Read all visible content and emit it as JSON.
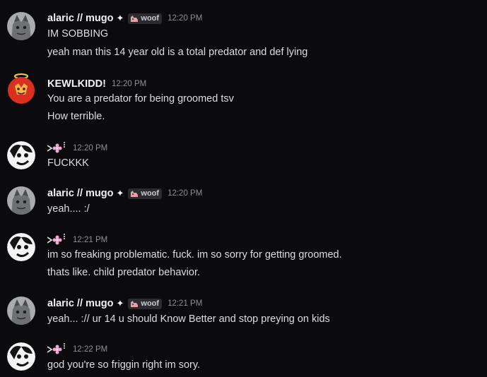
{
  "messages": [
    {
      "author": "alaric // mugo",
      "sparkle": "✦",
      "tag": "woof",
      "time": "12:20 PM",
      "lines": [
        "IM SOBBING",
        "yeah man this 14 year old is a total predator and def lying"
      ]
    },
    {
      "author": "KEWLKIDD!",
      "time": "12:20 PM",
      "lines": [
        "You are a predator for being groomed tsv",
        "How terrible."
      ]
    },
    {
      "time": "12:20 PM",
      "lines": [
        "FUCKKK"
      ]
    },
    {
      "author": "alaric // mugo",
      "sparkle": "✦",
      "tag": "woof",
      "time": "12:20 PM",
      "lines": [
        "yeah.... :/"
      ]
    },
    {
      "time": "12:21 PM",
      "lines": [
        "im so freaking problematic. fuck. im so sorry for getting groomed.",
        "thats like. child predator behavior."
      ]
    },
    {
      "author": "alaric // mugo",
      "sparkle": "✦",
      "tag": "woof",
      "time": "12:21 PM",
      "lines": [
        "yeah... :// ur 14 u should Know Better and stop preying on kids"
      ]
    },
    {
      "time": "12:22 PM",
      "lines": [
        "god you're so friggin right im sory."
      ]
    }
  ],
  "colors": {
    "background": "#0b0b0d",
    "username": "#f2f3f5",
    "text": "#dbdee1",
    "timestamp": "#8d9096",
    "tag_bg": "#2b2b30"
  },
  "icons": {
    "alaric_avatar": "wolf-avatar-icon",
    "kewlkidd_avatar": "halo-avatar-icon",
    "anon_avatar": "dog-face-avatar-icon",
    "anon_name": "flower-name-icon",
    "tag": "dog-tag-icon"
  }
}
